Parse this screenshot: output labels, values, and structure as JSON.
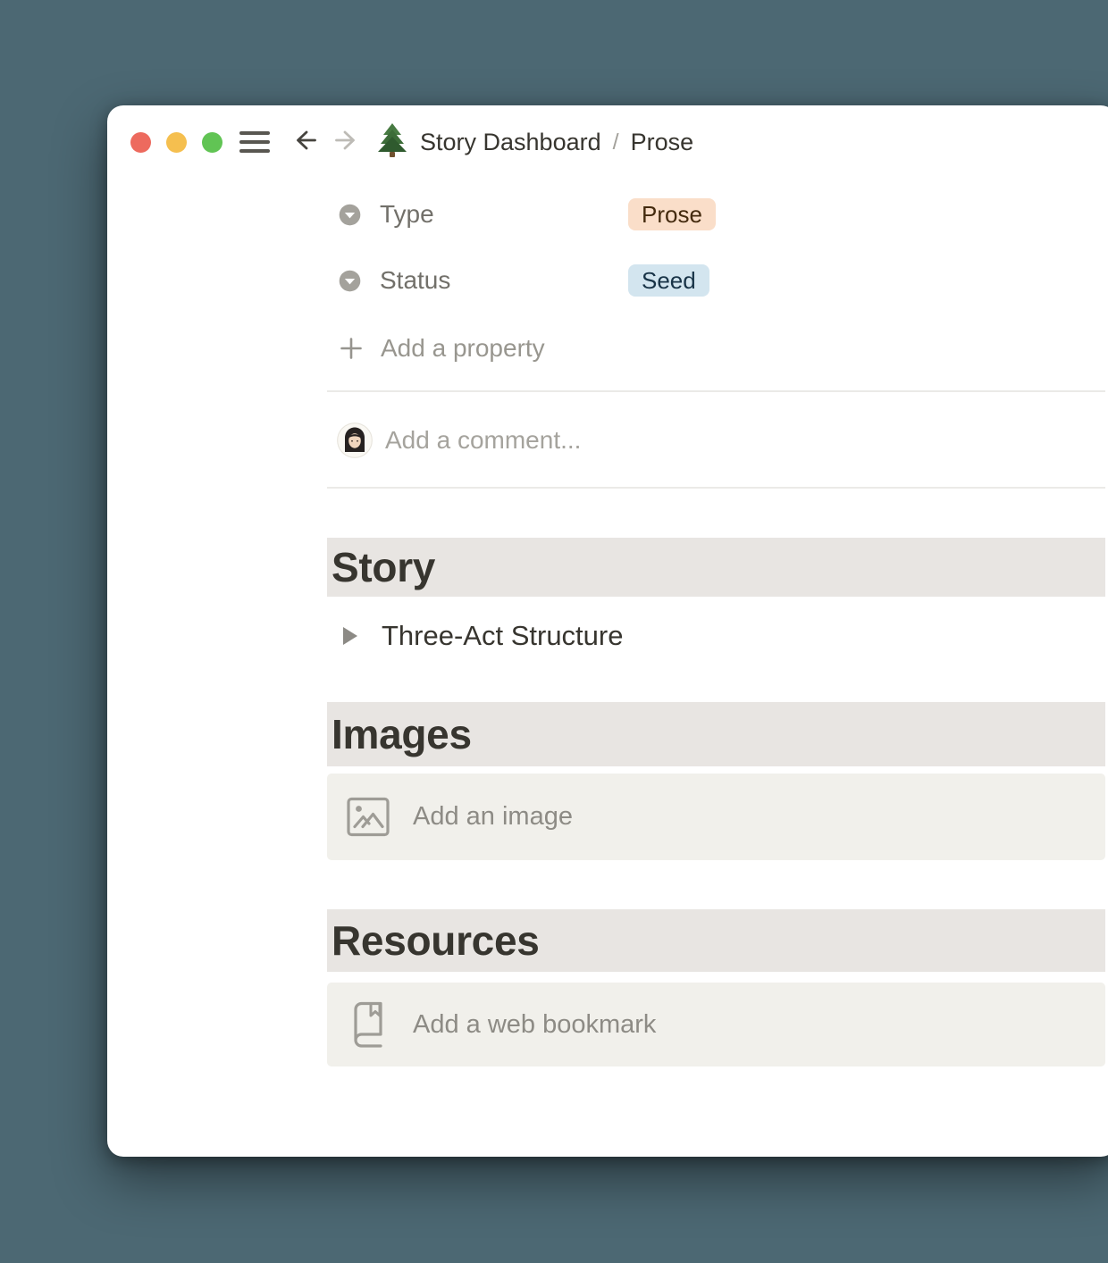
{
  "titlebar": {
    "breadcrumb": {
      "root": "Story Dashboard",
      "separator": "/",
      "current": "Prose"
    },
    "page_icon": "evergreen-tree-icon"
  },
  "properties": {
    "rows": [
      {
        "label": "Type",
        "value": "Prose",
        "value_bg": "#FADEC9",
        "value_text_color": "#442A0E"
      },
      {
        "label": "Status",
        "value": "Seed",
        "value_bg": "#D3E5EF",
        "value_text_color": "#183347"
      }
    ],
    "add_property_label": "Add a property"
  },
  "comment": {
    "placeholder": "Add a comment..."
  },
  "sections": [
    {
      "heading": "Story",
      "toggle_label": "Three-Act Structure"
    },
    {
      "heading": "Images",
      "placeholder": "Add an image"
    },
    {
      "heading": "Resources",
      "placeholder": "Add a web bookmark"
    }
  ],
  "colors": {
    "desktop_background": "#4C6873",
    "window_background": "#FFFFFF",
    "section_heading_background": "#E8E5E2",
    "placeholder_block_background": "#F1F0EB",
    "divider": "#EBEAE7",
    "text_primary": "#37352F",
    "text_muted": "#98968F",
    "tag_prose_background": "#FADEC9",
    "tag_seed_background": "#D3E5EF",
    "traffic_red": "#ED6A5E",
    "traffic_yellow": "#F5BF4F",
    "traffic_green": "#61C454"
  }
}
